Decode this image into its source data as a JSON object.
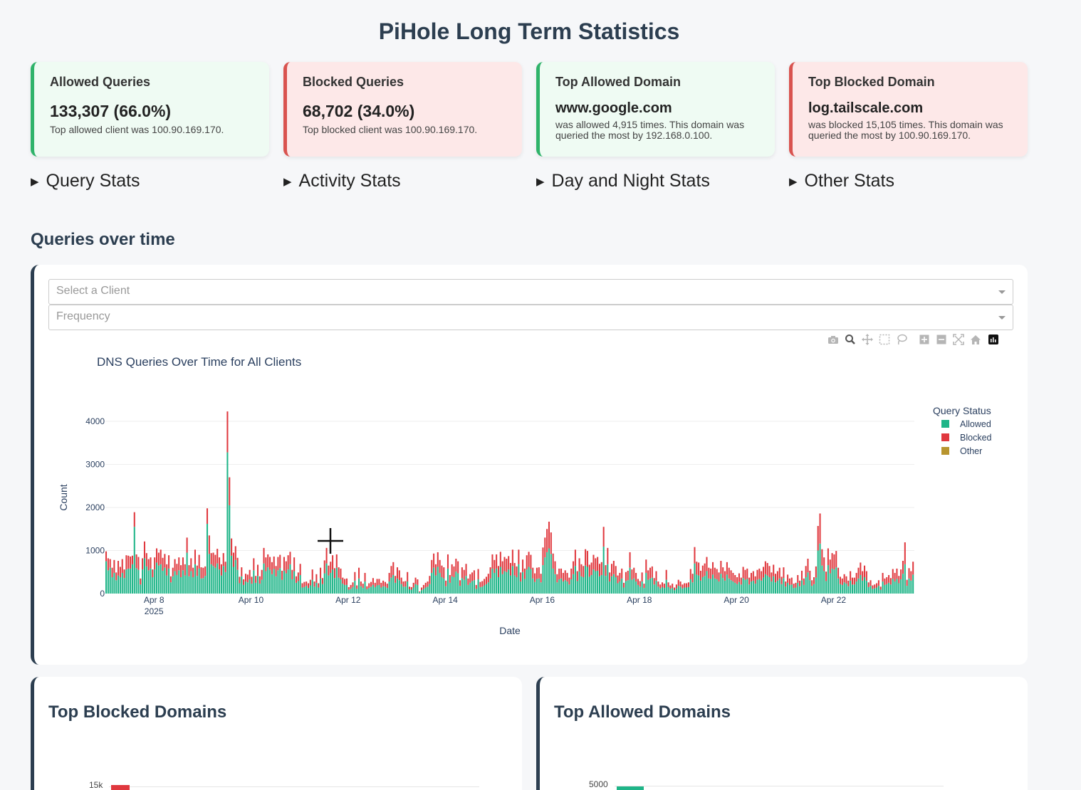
{
  "page": {
    "title": "PiHole Long Term Statistics"
  },
  "cards": [
    {
      "title": "Allowed Queries",
      "value": "133,307 (66.0%)",
      "sub": "Top allowed client was 100.90.169.170."
    },
    {
      "title": "Blocked Queries",
      "value": "68,702 (34.0%)",
      "sub": "Top blocked client was 100.90.169.170."
    },
    {
      "title": "Top Allowed Domain",
      "domain": "www.google.com",
      "sub": "was allowed 4,915 times. This domain was queried the most by 192.168.0.100."
    },
    {
      "title": "Top Blocked Domain",
      "domain": "log.tailscale.com",
      "sub": "was blocked 15,105 times. This domain was queried the most by 100.90.169.170."
    }
  ],
  "summaries": [
    "Query Stats",
    "Activity Stats",
    "Day and Night Stats",
    "Other Stats"
  ],
  "queries_section": {
    "heading": "Queries over time",
    "client_placeholder": "Select a Client",
    "frequency_placeholder": "Frequency"
  },
  "modebar": [
    "camera-icon",
    "zoom-icon",
    "pan-icon",
    "box-select-icon",
    "lasso-icon",
    "zoom-in-icon",
    "zoom-out-icon",
    "autoscale-icon",
    "reset-axes-icon",
    "plotly-logo"
  ],
  "colors": {
    "allowed": "#1fb588",
    "blocked": "#e0383e",
    "other": "#b8952f",
    "grid": "#eeeeee"
  },
  "chart_data": {
    "type": "bar",
    "stacked": true,
    "title": "DNS Queries Over Time for All Clients",
    "xlabel": "Date",
    "ylabel": "Count",
    "ylim": [
      0,
      4250
    ],
    "yticks": [
      0,
      1000,
      2000,
      3000,
      4000
    ],
    "xticks": [
      {
        "label": "Apr 8",
        "sub": "2025"
      },
      {
        "label": "Apr 10"
      },
      {
        "label": "Apr 12"
      },
      {
        "label": "Apr 14"
      },
      {
        "label": "Apr 16"
      },
      {
        "label": "Apr 18"
      },
      {
        "label": "Apr 20"
      },
      {
        "label": "Apr 22"
      }
    ],
    "x_range": [
      "2025-04-07 00:00",
      "2025-04-22 23:00"
    ],
    "interval": "hourly",
    "legend_title": "Query Status",
    "legend_position": "top-right",
    "series": [
      {
        "name": "Allowed",
        "values": [
          750,
          540,
          600,
          380,
          480,
          310,
          420,
          380,
          480,
          360,
          560,
          580,
          580,
          680,
          1550,
          590,
          550,
          210,
          560,
          820,
          630,
          540,
          580,
          380,
          560,
          720,
          650,
          680,
          530,
          600,
          420,
          580,
          260,
          400,
          520,
          430,
          540,
          380,
          540,
          420,
          950,
          400,
          520,
          380,
          680,
          410,
          580,
          350,
          360,
          410,
          1620,
          920,
          680,
          640,
          600,
          700,
          560,
          420,
          640,
          500,
          3280,
          2050,
          880,
          620,
          780,
          550,
          240,
          400,
          200,
          280,
          260,
          330,
          230,
          540,
          250,
          410,
          230,
          320,
          700,
          520,
          610,
          550,
          450,
          570,
          400,
          540,
          590,
          320,
          530,
          470,
          560,
          680,
          330,
          520,
          250,
          290,
          430,
          140,
          150,
          180,
          130,
          190,
          320,
          160,
          250,
          140,
          350,
          220,
          470,
          700,
          420,
          480,
          560,
          360,
          600,
          370,
          330,
          230,
          200,
          200,
          90,
          110,
          150,
          300,
          110,
          350,
          170,
          130,
          280,
          100,
          130,
          160,
          200,
          150,
          190,
          200,
          140,
          170,
          160,
          130,
          280,
          370,
          430,
          250,
          350,
          310,
          220,
          160,
          160,
          280,
          100,
          90,
          140,
          220,
          200,
          30,
          80,
          110,
          140,
          160,
          220,
          480,
          600,
          420,
          620,
          480,
          380,
          350,
          170,
          580,
          250,
          400,
          380,
          510,
          470,
          180,
          360,
          320,
          410,
          200,
          250,
          290,
          310,
          110,
          330,
          150,
          160,
          190,
          220,
          260,
          350,
          580,
          480,
          580,
          380,
          620,
          450,
          520,
          500,
          560,
          420,
          640,
          420,
          380,
          680,
          280,
          500,
          340,
          560,
          620,
          570,
          350,
          270,
          340,
          350,
          260,
          660,
          840,
          960,
          1050,
          920,
          580,
          450,
          260,
          330,
          350,
          280,
          310,
          280,
          210,
          330,
          450,
          640,
          290,
          510,
          400,
          380,
          650,
          620,
          390,
          430,
          560,
          520,
          530,
          400,
          430,
          1090,
          410,
          680,
          280,
          400,
          450,
          380,
          240,
          280,
          350,
          140,
          290,
          310,
          600,
          320,
          350,
          280,
          200,
          160,
          280,
          130,
          480,
          320,
          350,
          370,
          210,
          300,
          160,
          120,
          150,
          130,
          320,
          150,
          110,
          130,
          80,
          120,
          180,
          160,
          120,
          140,
          140,
          150,
          330,
          260,
          700,
          440,
          420,
          300,
          380,
          410,
          520,
          350,
          340,
          440,
          350,
          330,
          280,
          460,
          360,
          300,
          440,
          350,
          310,
          280,
          250,
          220,
          270,
          210,
          360,
          320,
          340,
          210,
          280,
          300,
          230,
          320,
          340,
          300,
          370,
          450,
          420,
          380,
          280,
          400,
          260,
          300,
          350,
          220,
          360,
          160,
          250,
          200,
          210,
          130,
          140,
          250,
          170,
          310,
          200,
          380,
          490,
          310,
          180,
          220,
          370,
          1000,
          1160,
          650,
          520,
          290,
          660,
          470,
          580,
          560,
          610,
          350,
          220,
          200,
          260,
          230,
          170,
          300,
          210,
          210,
          280,
          350,
          430,
          300,
          380,
          300,
          150,
          180,
          110,
          120,
          140,
          180,
          90,
          280,
          200,
          220,
          250,
          210,
          340,
          280,
          340,
          240,
          330,
          460,
          680,
          180,
          350,
          300,
          440
        ]
      },
      {
        "name": "Blocked",
        "values": [
          230,
          280,
          200,
          220,
          300,
          180,
          340,
          240,
          320,
          200,
          330,
          300,
          280,
          200,
          340,
          320,
          300,
          140,
          260,
          390,
          310,
          260,
          260,
          180,
          280,
          330,
          300,
          340,
          300,
          320,
          260,
          310,
          140,
          200,
          280,
          260,
          300,
          280,
          300,
          260,
          350,
          260,
          300,
          220,
          340,
          240,
          320,
          260,
          240,
          220,
          360,
          430,
          260,
          310,
          300,
          340,
          280,
          260,
          300,
          240,
          950,
          650,
          400,
          330,
          320,
          280,
          150,
          210,
          130,
          180,
          180,
          220,
          160,
          280,
          160,
          260,
          170,
          230,
          360,
          320,
          300,
          300,
          280,
          290,
          240,
          310,
          310,
          210,
          320,
          280,
          330,
          290,
          220,
          320,
          150,
          200,
          260,
          100,
          120,
          100,
          110,
          130,
          240,
          120,
          200,
          100,
          250,
          140,
          300,
          360,
          230,
          260,
          330,
          230,
          310,
          240,
          250,
          140,
          140,
          150,
          60,
          90,
          110,
          200,
          80,
          250,
          110,
          100,
          200,
          70,
          110,
          110,
          160,
          100,
          150,
          140,
          110,
          130,
          110,
          100,
          200,
          270,
          300,
          160,
          260,
          230,
          150,
          120,
          130,
          220,
          60,
          60,
          110,
          150,
          130,
          20,
          60,
          90,
          110,
          120,
          190,
          300,
          330,
          260,
          340,
          300,
          270,
          260,
          130,
          330,
          180,
          280,
          250,
          300,
          280,
          130,
          250,
          230,
          280,
          150,
          200,
          200,
          230,
          90,
          240,
          120,
          130,
          150,
          170,
          200,
          260,
          330,
          300,
          330,
          260,
          350,
          300,
          330,
          310,
          310,
          290,
          380,
          290,
          250,
          340,
          210,
          290,
          240,
          330,
          350,
          330,
          250,
          200,
          260,
          260,
          200,
          410,
          460,
          540,
          620,
          500,
          350,
          300,
          190,
          250,
          230,
          200,
          230,
          200,
          160,
          250,
          300,
          380,
          230,
          310,
          280,
          260,
          380,
          370,
          280,
          290,
          340,
          300,
          320,
          290,
          300,
          460,
          250,
          380,
          210,
          290,
          310,
          260,
          180,
          200,
          230,
          110,
          210,
          220,
          360,
          240,
          250,
          200,
          140,
          130,
          210,
          100,
          310,
          220,
          250,
          260,
          150,
          220,
          120,
          90,
          110,
          100,
          230,
          110,
          80,
          100,
          60,
          90,
          140,
          120,
          90,
          100,
          100,
          110,
          240,
          200,
          380,
          300,
          300,
          230,
          270,
          290,
          330,
          250,
          240,
          290,
          250,
          240,
          210,
          300,
          250,
          220,
          290,
          250,
          230,
          200,
          180,
          160,
          200,
          160,
          260,
          230,
          240,
          160,
          200,
          220,
          170,
          230,
          240,
          220,
          250,
          300,
          290,
          260,
          210,
          270,
          200,
          220,
          250,
          170,
          250,
          120,
          190,
          150,
          160,
          100,
          110,
          180,
          130,
          220,
          150,
          260,
          320,
          220,
          130,
          160,
          260,
          570,
          700,
          380,
          320,
          220,
          390,
          320,
          360,
          350,
          380,
          250,
          170,
          150,
          190,
          170,
          130,
          220,
          160,
          160,
          200,
          250,
          290,
          220,
          270,
          220,
          110,
          130,
          80,
          90,
          100,
          130,
          70,
          200,
          150,
          160,
          180,
          150,
          230,
          200,
          240,
          170,
          230,
          300,
          510,
          140,
          240,
          220,
          300
        ]
      },
      {
        "name": "Other",
        "values": []
      }
    ]
  },
  "bottom_left": {
    "title": "Top Blocked Domains",
    "tick": "15k"
  },
  "bottom_right": {
    "title": "Top Allowed Domains",
    "tick": "5000"
  }
}
